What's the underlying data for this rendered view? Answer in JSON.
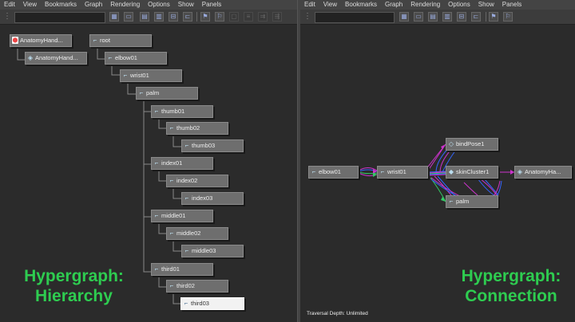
{
  "menu": [
    "Edit",
    "View",
    "Bookmarks",
    "Graph",
    "Rendering",
    "Options",
    "Show",
    "Panels"
  ],
  "left": {
    "title_line1": "Hypergraph:",
    "title_line2": "Hierarchy",
    "nodes": {
      "anatomy_hand": "AnatomyHand...",
      "anatomy_hand_shape": "AnatomyHand...",
      "root": "root",
      "elbow01": "elbow01",
      "wrist01": "wrist01",
      "palm": "palm",
      "thumb01": "thumb01",
      "thumb02": "thumb02",
      "thumb03": "thumb03",
      "index01": "index01",
      "index02": "index02",
      "index03": "index03",
      "middle01": "middle01",
      "middle02": "middle02",
      "middle03": "middle03",
      "third01": "third01",
      "third02": "third02",
      "third03": "third03"
    }
  },
  "right": {
    "title_line1": "Hypergraph:",
    "title_line2": "Connection",
    "footer": "Traversal Depth: Unlimited",
    "nodes": {
      "elbow01": "elbow01",
      "wrist01": "wrist01",
      "bindpose1": "bindPose1",
      "skincluster1": "skinCluster1",
      "palm": "palm",
      "anatomy_hand": "AnatomyHa..."
    }
  },
  "colors": {
    "label_green": "#2ecc50",
    "edge_magenta": "#cc33cc",
    "edge_blue": "#3366ff",
    "edge_green": "#33cc66"
  }
}
